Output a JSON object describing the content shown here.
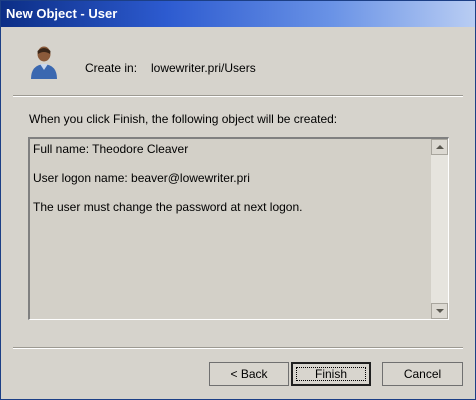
{
  "window": {
    "title": "New Object - User"
  },
  "header": {
    "create_label": "Create in:",
    "create_path": "lowewriter.pri/Users"
  },
  "main": {
    "intro": "When you click Finish, the following object will be created:",
    "summary_lines": [
      "Full name: Theodore Cleaver",
      "User logon name: beaver@lowewriter.pri",
      "The user must change the password at next logon."
    ]
  },
  "buttons": {
    "back": "< Back",
    "finish": "Finish",
    "cancel": "Cancel"
  },
  "colors": {
    "titlebar_start": "#0c2e86",
    "titlebar_end": "#b9cdf3",
    "dialog_bg": "#d6d3cc"
  },
  "icons": {
    "header": "user-icon",
    "scroll_up": "scroll-up-arrow",
    "scroll_down": "scroll-down-arrow"
  }
}
